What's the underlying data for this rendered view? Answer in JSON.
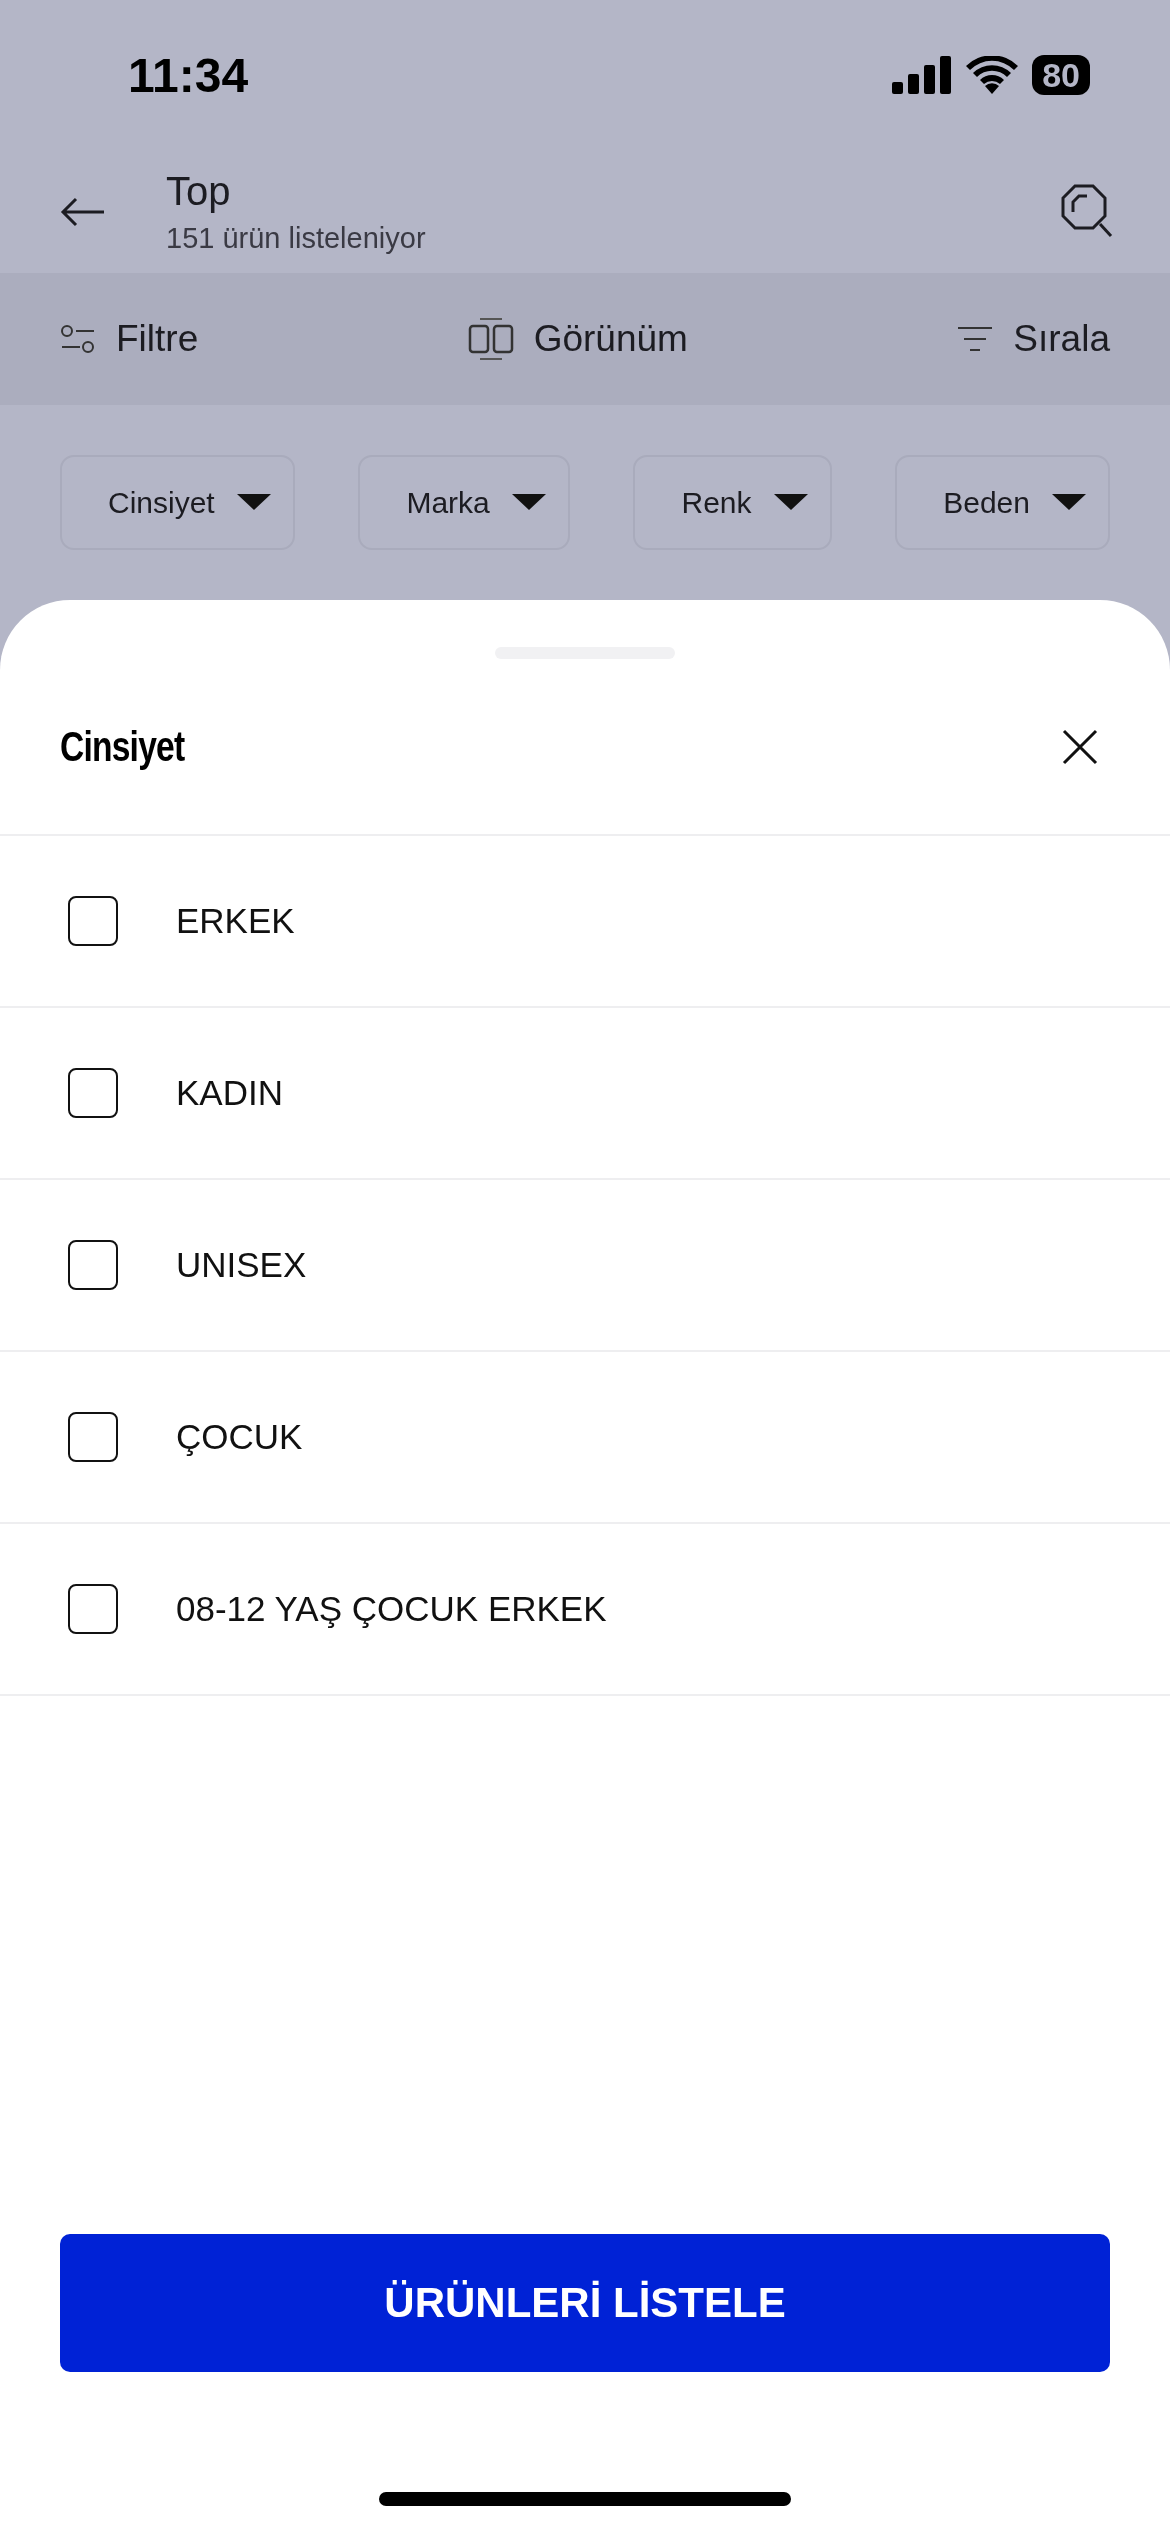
{
  "status_bar": {
    "time": "11:34",
    "battery": "80"
  },
  "header": {
    "title": "Top",
    "subtitle": "151 ürün listeleniyor"
  },
  "toolbar": [
    {
      "kind": "filter",
      "label": "Filtre"
    },
    {
      "kind": "view",
      "label": "Görünüm"
    },
    {
      "kind": "sort",
      "label": "Sırala"
    }
  ],
  "filter_chips": [
    {
      "label": "Cinsiyet"
    },
    {
      "label": "Marka"
    },
    {
      "label": "Renk"
    },
    {
      "label": "Beden"
    }
  ],
  "sheet": {
    "title": "Cinsiyet",
    "options": [
      {
        "label": "ERKEK",
        "checked": false
      },
      {
        "label": "KADIN",
        "checked": false
      },
      {
        "label": "UNISEX",
        "checked": false
      },
      {
        "label": "ÇOCUK",
        "checked": false
      },
      {
        "label": "08-12 YAŞ ÇOCUK ERKEK",
        "checked": false
      }
    ],
    "button": "ÜRÜNLERİ LİSTELE"
  }
}
